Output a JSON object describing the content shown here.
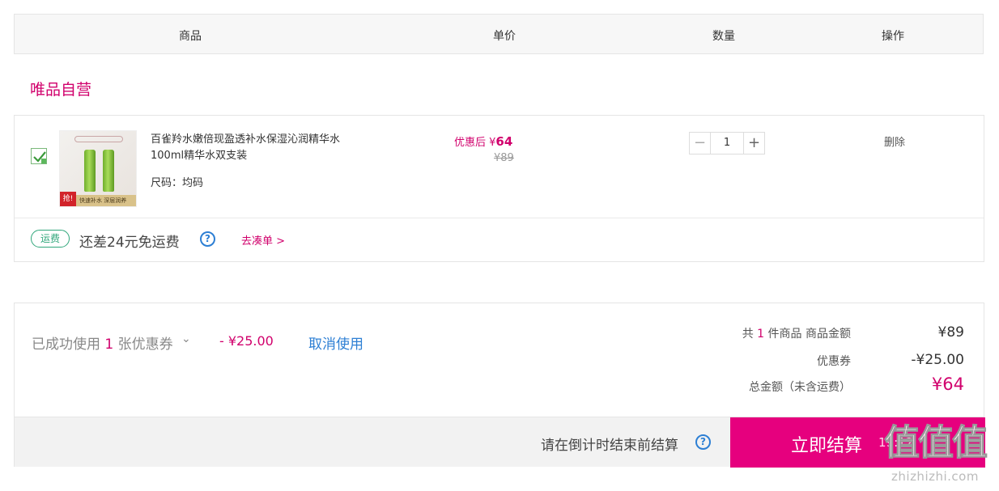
{
  "header": {
    "col_product": "商品",
    "col_price": "单价",
    "col_qty": "数量",
    "col_action": "操作"
  },
  "shop": {
    "title": "唯品自营"
  },
  "item": {
    "checked": true,
    "thumb": {
      "badge": "抢!",
      "banner": "快速补水 深层润养"
    },
    "name": "百雀羚水嫩倍现盈透补水保湿沁润精华水100ml精华水双支装",
    "size": "尺码：均码",
    "price_after_label": "优惠后 ¥",
    "price_after_value": "64",
    "price_original": "¥89",
    "quantity": "1",
    "minus": "−",
    "plus": "+",
    "delete": "删除"
  },
  "shipping": {
    "badge": "运费",
    "text": "还差24元免运费",
    "help": "?",
    "go_add": "去凑单 >"
  },
  "summary": {
    "coupon_prefix": "已成功使用",
    "coupon_count": "1",
    "coupon_suffix": "张优惠券",
    "coupon_chevron": "⌄",
    "coupon_amount": "- ¥25.00",
    "cancel_use": "取消使用",
    "count_prefix": "共",
    "count_value": "1",
    "count_suffix": "件商品  商品金额",
    "goods_amount": "¥89",
    "coupon_label": "优惠券",
    "coupon_value": "-¥25.00",
    "total_label": "总金额（未含运费）",
    "total_value": "¥64"
  },
  "checkout_bar": {
    "hint": "请在倒计时结束前结算",
    "help": "?",
    "button": "立即结算",
    "timer": "19:12"
  },
  "watermark": {
    "big": "值值值",
    "small": "zhizhizhi.com"
  },
  "colors": {
    "accent": "#e6007e",
    "price": "#d1006c",
    "link": "#2d7fd4",
    "ship": "#2fa67a"
  }
}
